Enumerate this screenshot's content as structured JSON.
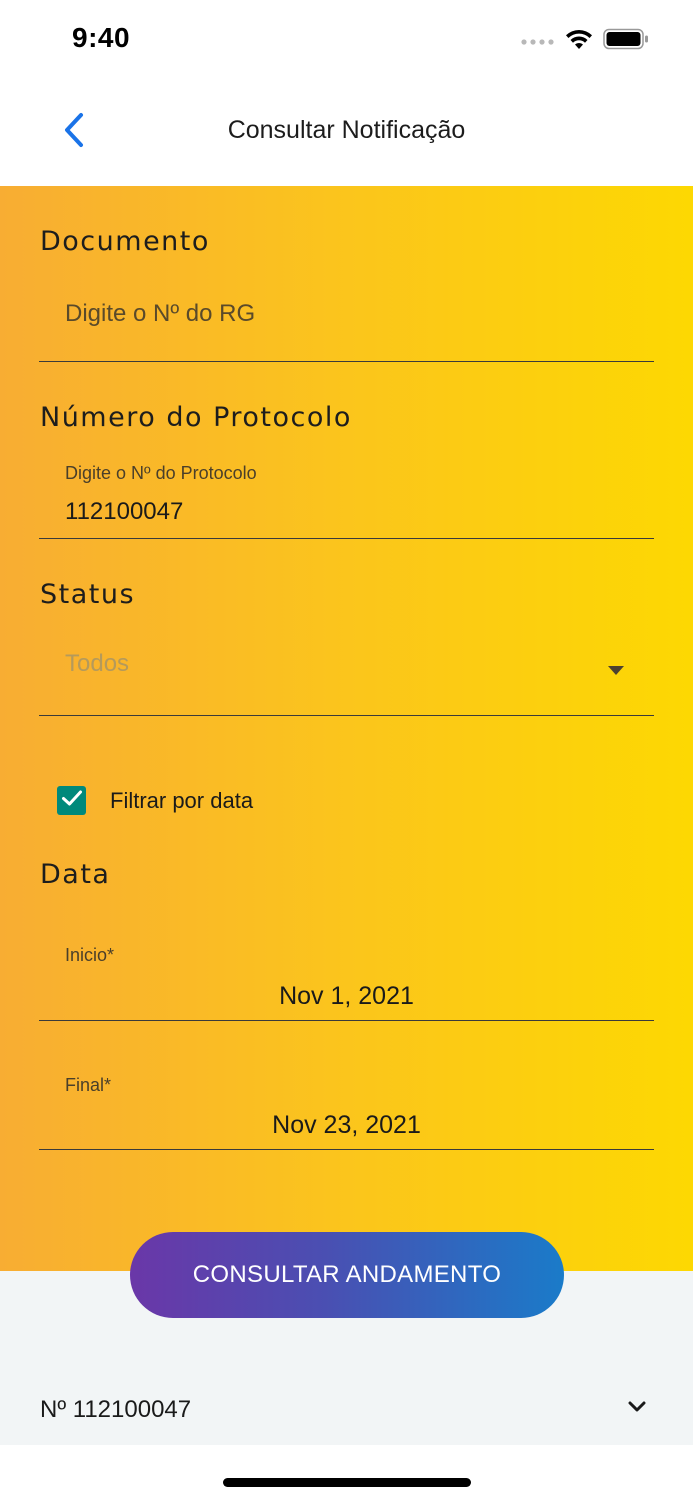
{
  "status_bar": {
    "time": "9:40",
    "signal_icon": "cellular-signal-icon",
    "wifi_icon": "wifi-icon",
    "battery_icon": "battery-icon"
  },
  "nav": {
    "back_icon": "chevron-left-icon",
    "title": "Consultar Notificação",
    "accent_color": "#1a73e8"
  },
  "form": {
    "background_gradient": [
      "#f8ad33",
      "#fdd802"
    ],
    "documento": {
      "label": "Documento",
      "placeholder": "Digite o Nº do RG",
      "value": ""
    },
    "protocolo": {
      "label": "Número do Protocolo",
      "floating_label": "Digite o Nº do Protocolo",
      "value": "112100047"
    },
    "status": {
      "label": "Status",
      "selected": "Todos",
      "caret_icon": "dropdown-caret-icon"
    },
    "filtrar_data": {
      "checked": true,
      "label": "Filtrar por data",
      "color": "#00897b"
    },
    "data": {
      "label": "Data",
      "inicio": {
        "label": "Inicio*",
        "value": "Nov 1, 2021"
      },
      "final": {
        "label": "Final*",
        "value": "Nov 23, 2021"
      }
    }
  },
  "actions": {
    "consultar_label": "CONSULTAR ANDAMENTO",
    "button_gradient": [
      "#6a37a8",
      "#1a7bc9"
    ]
  },
  "results": [
    {
      "label": "Nº 112100047",
      "expand_icon": "chevron-down-icon"
    }
  ]
}
